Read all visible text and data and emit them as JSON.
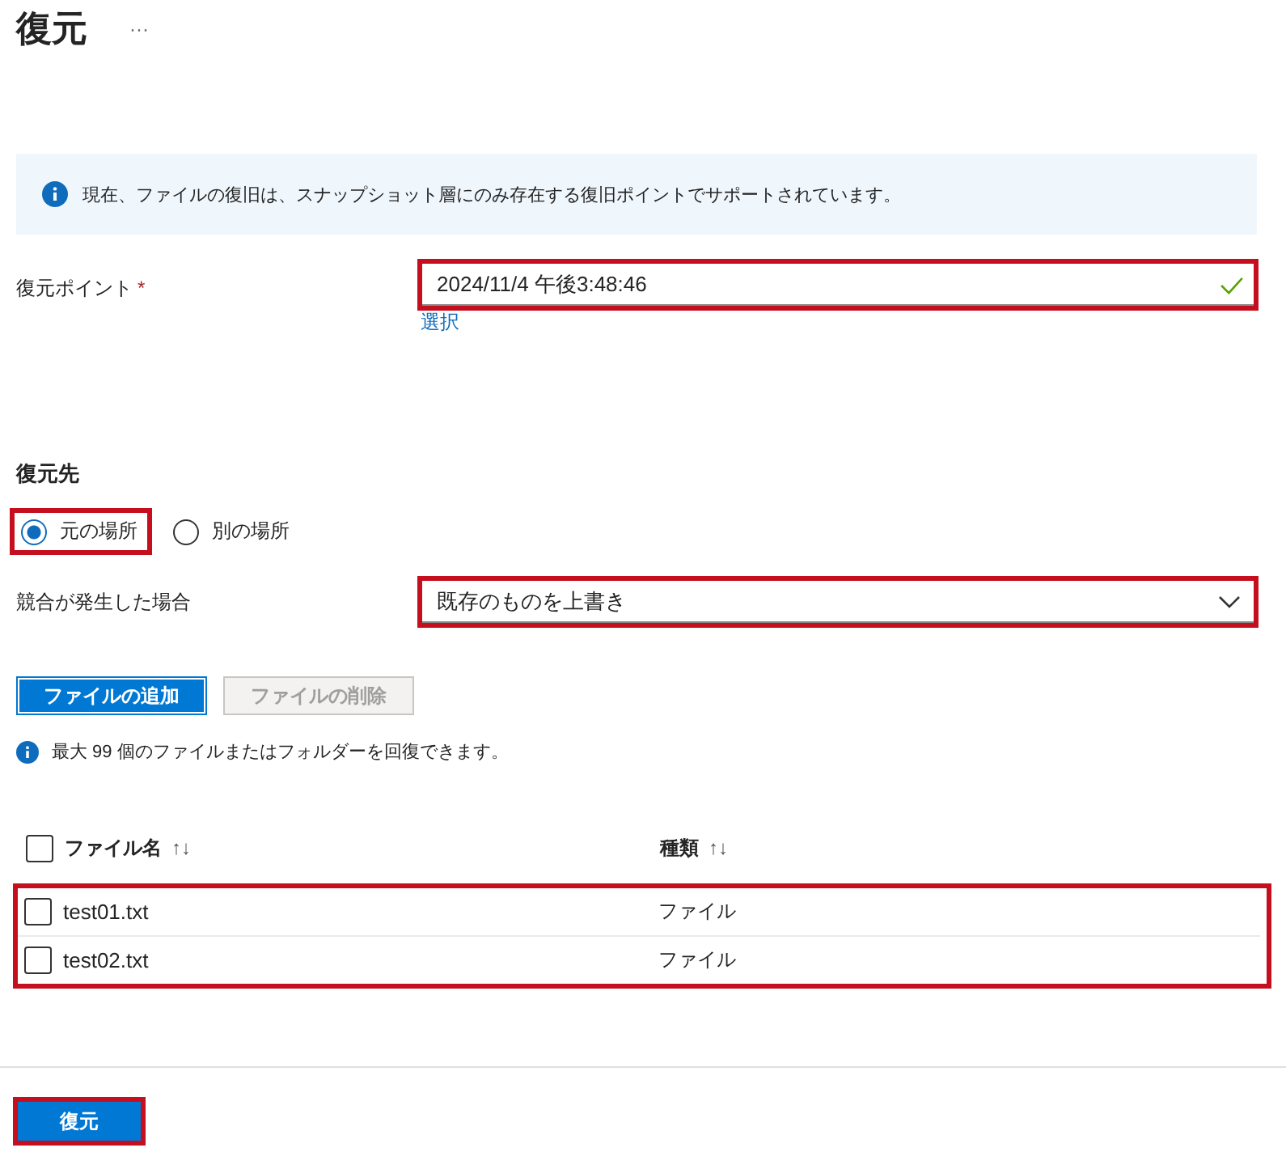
{
  "title": "復元",
  "more": "···",
  "info_banner": {
    "text": "現在、ファイルの復旧は、スナップショット層にのみ存在する復旧ポイントでサポートされています。"
  },
  "restore_point": {
    "label": "復元ポイント",
    "required_mark": "*",
    "value": "2024/11/4 午後3:48:46",
    "valid": true,
    "highlighted": true,
    "link": "選択"
  },
  "destination": {
    "heading": "復元先",
    "options": [
      {
        "label": "元の場所",
        "selected": true,
        "highlighted": true
      },
      {
        "label": "別の場所",
        "selected": false,
        "highlighted": false
      }
    ]
  },
  "conflict": {
    "label": "競合が発生した場合",
    "value": "既存のものを上書き",
    "highlighted": true
  },
  "buttons": [
    {
      "label": "ファイルの追加",
      "disabled": false
    },
    {
      "label": "ファイルの削除",
      "disabled": true
    }
  ],
  "note": "最大 99 個のファイルまたはフォルダーを回復できます。",
  "table": {
    "columns": [
      {
        "label": "ファイル名",
        "sort": "↑↓"
      },
      {
        "label": "種類",
        "sort": "↑↓"
      }
    ],
    "all_checked": false,
    "rows_highlighted": true,
    "rows": [
      {
        "name": "test01.txt",
        "type": "ファイル",
        "checked": false
      },
      {
        "name": "test02.txt",
        "type": "ファイル",
        "checked": false
      }
    ]
  },
  "submit": {
    "label": "復元",
    "highlighted": true
  }
}
